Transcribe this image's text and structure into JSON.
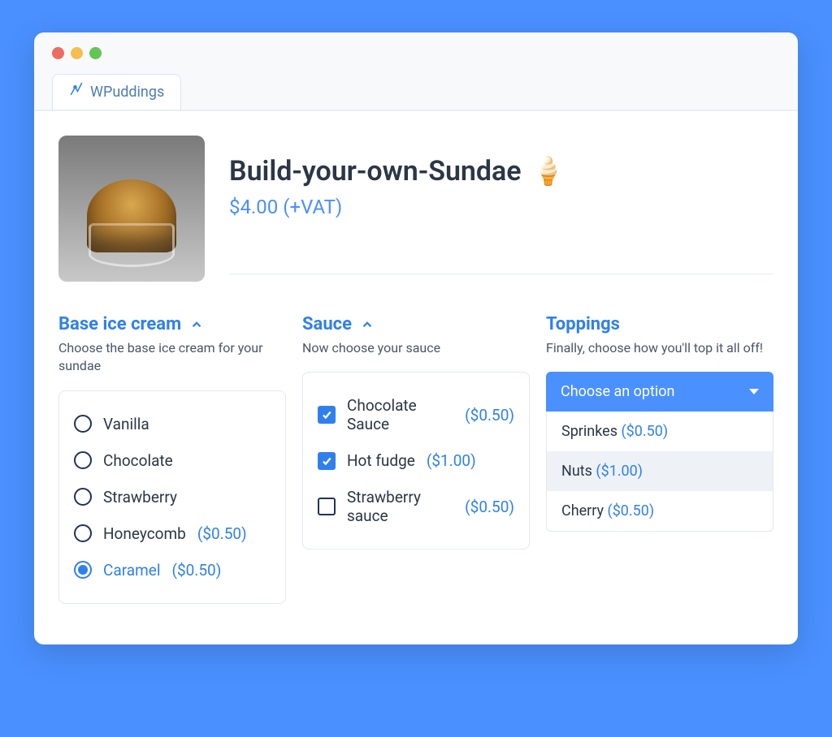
{
  "tab": {
    "label": "WPuddings"
  },
  "product": {
    "title": "Build-your-own-Sundae",
    "emoji": "🍦",
    "price": "$4.00 (+VAT)"
  },
  "sections": {
    "base": {
      "title": "Base ice cream",
      "desc": "Choose the base ice cream for your sundae",
      "options": [
        {
          "label": "Vanilla",
          "price": "",
          "selected": false
        },
        {
          "label": "Chocolate",
          "price": "",
          "selected": false
        },
        {
          "label": "Strawberry",
          "price": "",
          "selected": false
        },
        {
          "label": "Honeycomb",
          "price": "($0.50)",
          "selected": false
        },
        {
          "label": "Caramel",
          "price": "($0.50)",
          "selected": true
        }
      ]
    },
    "sauce": {
      "title": "Sauce",
      "desc": "Now choose your sauce",
      "options": [
        {
          "label": "Chocolate Sauce",
          "price": "($0.50)",
          "checked": true
        },
        {
          "label": "Hot fudge",
          "price": "($1.00)",
          "checked": true
        },
        {
          "label": "Strawberry sauce",
          "price": "($0.50)",
          "checked": false
        }
      ]
    },
    "toppings": {
      "title": "Toppings",
      "desc": "Finally, choose how you'll top it all off!",
      "placeholder": "Choose an option",
      "options": [
        {
          "label": "Sprinkes",
          "price": "($0.50)",
          "hover": false
        },
        {
          "label": "Nuts",
          "price": "($1.00)",
          "hover": true
        },
        {
          "label": "Cherry",
          "price": "($0.50)",
          "hover": false
        }
      ]
    }
  }
}
